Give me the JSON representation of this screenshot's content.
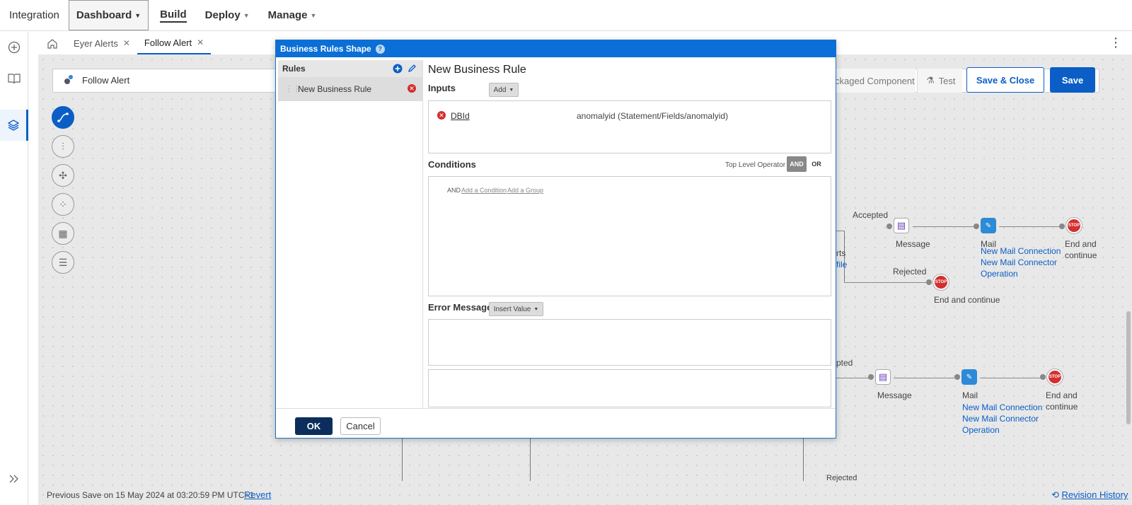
{
  "topnav": {
    "brand": "Integration",
    "items": [
      {
        "label": "Dashboard"
      },
      {
        "label": "Build"
      },
      {
        "label": "Deploy"
      },
      {
        "label": "Manage"
      }
    ]
  },
  "tabs": [
    {
      "label": "Eyer Alerts"
    },
    {
      "label": "Follow Alert"
    }
  ],
  "process": {
    "name": "Follow Alert",
    "packaged_component": "ckaged Component",
    "test_label": "Test",
    "save_close_label": "Save & Close",
    "save_label": "Save"
  },
  "canvas": {
    "accepted_label": "Accepted",
    "rejected_label": "Rejected",
    "rts_fragment": "rts",
    "file_fragment": "file",
    "message_label": "Message",
    "mail_label": "Mail",
    "end_label_1": "End and",
    "end_label_2": "continue",
    "end_and_continue": "End and continue",
    "connection_link": "New Mail Connection",
    "operation_link_1": "New Mail Connector",
    "operation_link_2": "Operation",
    "pted_fragment": "pted",
    "rejected_bottom": "Rejected",
    "stop_text": "STOP"
  },
  "footer": {
    "previous_save": "Previous Save on 15 May 2024 at 03:20:59 PM UTC+1",
    "revert_label": "Revert",
    "revision_history_label": "Revision History"
  },
  "modal": {
    "title": "Business Rules Shape",
    "help": "?",
    "rules_header": "Rules",
    "rule_item": "New Business Rule",
    "rule_title": "New Business Rule",
    "inputs_label": "Inputs",
    "add_label": "Add",
    "input_name": "DBId",
    "input_value": "anomalyid (Statement/Fields/anomalyid)",
    "conditions_label": "Conditions",
    "top_level_operator_label": "Top Level Operator",
    "and_label": "AND",
    "or_label": "OR",
    "condition_prefix": "AND",
    "add_condition": "Add a Condition",
    "add_group": "Add a Group",
    "error_message_label": "Error Message",
    "insert_value_label": "Insert Value",
    "ok_label": "OK",
    "cancel_label": "Cancel"
  },
  "colors": {
    "accent": "#0a5ec6",
    "modal_header": "#0a6fd6",
    "ok_button": "#0b2e5c",
    "error": "#d32f2f"
  }
}
